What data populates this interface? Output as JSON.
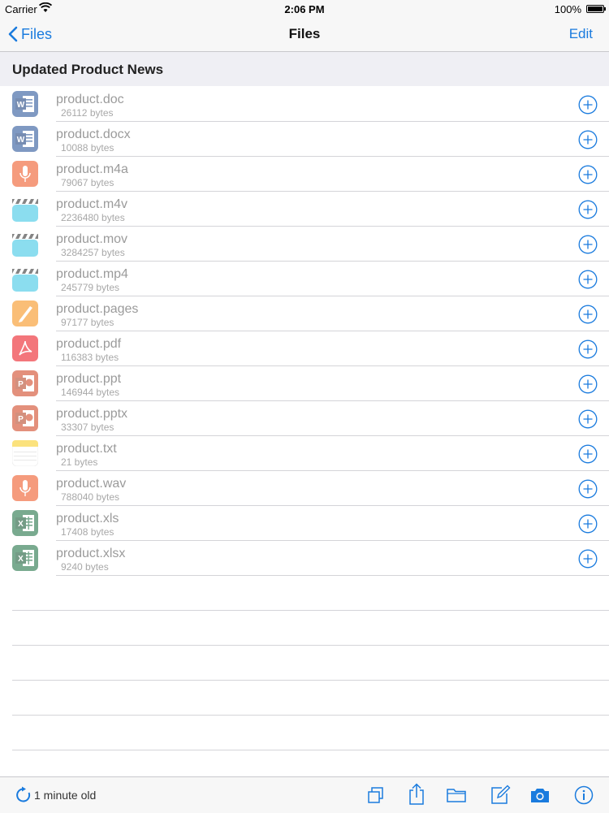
{
  "status_bar": {
    "carrier": "Carrier",
    "time": "2:06 PM",
    "battery": "100%"
  },
  "nav": {
    "back_label": "Files",
    "title": "Files",
    "edit_label": "Edit"
  },
  "section": {
    "title": "Updated Product News"
  },
  "files": [
    {
      "name": "product.doc",
      "size": "26112 bytes",
      "icon": "word-icon"
    },
    {
      "name": "product.docx",
      "size": "10088 bytes",
      "icon": "word-icon"
    },
    {
      "name": "product.m4a",
      "size": "79067 bytes",
      "icon": "microphone-icon"
    },
    {
      "name": "product.m4v",
      "size": "2236480 bytes",
      "icon": "video-clapper-icon"
    },
    {
      "name": "product.mov",
      "size": "3284257 bytes",
      "icon": "video-clapper-icon"
    },
    {
      "name": "product.mp4",
      "size": "245779 bytes",
      "icon": "video-clapper-icon"
    },
    {
      "name": "product.pages",
      "size": "97177 bytes",
      "icon": "pages-icon"
    },
    {
      "name": "product.pdf",
      "size": "116383 bytes",
      "icon": "pdf-icon"
    },
    {
      "name": "product.ppt",
      "size": "146944 bytes",
      "icon": "powerpoint-icon"
    },
    {
      "name": "product.pptx",
      "size": "33307 bytes",
      "icon": "powerpoint-icon"
    },
    {
      "name": "product.txt",
      "size": "21 bytes",
      "icon": "notes-icon"
    },
    {
      "name": "product.wav",
      "size": "788040 bytes",
      "icon": "microphone-icon"
    },
    {
      "name": "product.xls",
      "size": "17408 bytes",
      "icon": "excel-icon"
    },
    {
      "name": "product.xlsx",
      "size": "9240 bytes",
      "icon": "excel-icon"
    }
  ],
  "toolbar": {
    "status": "1 minute old",
    "buttons": [
      "copy-icon",
      "share-icon",
      "folder-icon",
      "compose-icon",
      "camera-icon",
      "info-icon"
    ]
  },
  "colors": {
    "accent": "#1a7bde",
    "word": "#2b579a",
    "excel": "#217346",
    "powerpoint": "#d24726",
    "pdf": "#ec1c24",
    "audio": "#f05a28",
    "video": "#3fc8e6",
    "pages": "#f7941d",
    "notes": "#f9d028"
  }
}
